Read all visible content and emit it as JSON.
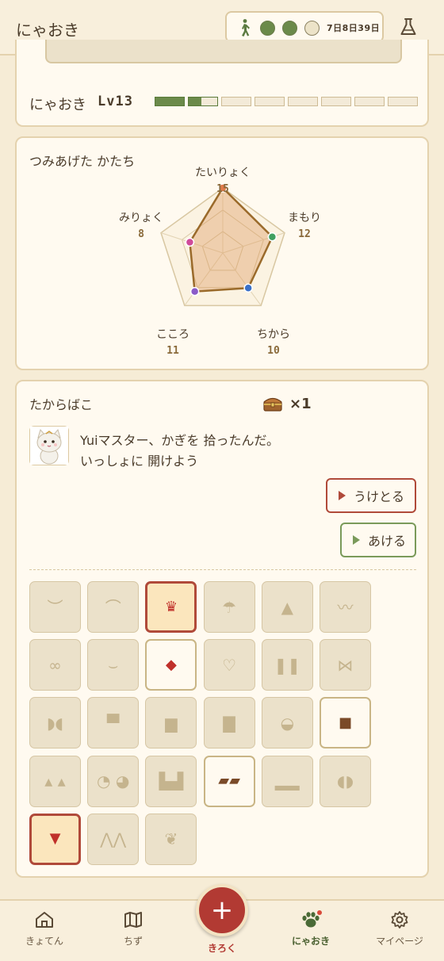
{
  "header": {
    "title": "にゃおき",
    "walk_time": "7日8日39日",
    "walk_time_display": "7日8日39日",
    "dots": [
      {
        "state": "filled",
        "color": "#6b8a4a"
      },
      {
        "state": "filled",
        "color": "#6b8a4a"
      },
      {
        "state": "empty",
        "color": "#ece3c8"
      }
    ]
  },
  "profile": {
    "name": "にゃおき",
    "level_label": "Lv13",
    "level_progress": {
      "segments": 8,
      "filled": 1,
      "partial_fraction": 0.45
    }
  },
  "stats": {
    "heading": "つみあげた かたち",
    "items": [
      {
        "label": "たいりょく",
        "value": "15",
        "color": "#e07a4a"
      },
      {
        "label": "まもり",
        "value": "12",
        "color": "#3fa060"
      },
      {
        "label": "ちから",
        "value": "10",
        "color": "#3a70c8"
      },
      {
        "label": "こころ",
        "value": "11",
        "color": "#8a5ac8"
      },
      {
        "label": "みりょく",
        "value": "8",
        "color": "#d04a9a"
      }
    ],
    "max": 15
  },
  "treasure": {
    "heading": "たからばこ",
    "count": "×1",
    "message_line1": "Yuiマスター、かぎを 拾ったんだ。",
    "message_line2": "いっしょに 開けよう",
    "receive_label": "うけとる",
    "open_label": "あける"
  },
  "items_grid": [
    {
      "icon": "cat-ears-icon",
      "glyph": "︶",
      "state": "locked"
    },
    {
      "icon": "headband-icon",
      "glyph": "⌒",
      "state": "locked"
    },
    {
      "icon": "tiara-icon",
      "glyph": "♛",
      "state": "equipped"
    },
    {
      "icon": "umbrella-hat-icon",
      "glyph": "☂",
      "state": "locked"
    },
    {
      "icon": "witch-hat-icon",
      "glyph": "▲",
      "state": "locked"
    },
    {
      "icon": "feather-icon",
      "glyph": "〰",
      "state": "locked"
    },
    {
      "icon": "glasses-icon",
      "glyph": "∞",
      "state": "locked"
    },
    {
      "icon": "necklace-icon",
      "glyph": "⌣",
      "state": "locked"
    },
    {
      "icon": "red-scarf-icon",
      "glyph": "◆",
      "state": "owned"
    },
    {
      "icon": "pendant-icon",
      "glyph": "♡",
      "state": "locked"
    },
    {
      "icon": "collar-icon",
      "glyph": "❚❚",
      "state": "locked"
    },
    {
      "icon": "bow-icon",
      "glyph": "⋈",
      "state": "locked"
    },
    {
      "icon": "leaf-pair-icon",
      "glyph": "◗◖",
      "state": "locked"
    },
    {
      "icon": "shirt-icon",
      "glyph": "▀",
      "state": "locked"
    },
    {
      "icon": "vest-icon",
      "glyph": "▆",
      "state": "locked"
    },
    {
      "icon": "dress-icon",
      "glyph": "▇",
      "state": "locked"
    },
    {
      "icon": "cape-icon",
      "glyph": "◒",
      "state": "locked"
    },
    {
      "icon": "brown-jacket-icon",
      "glyph": "■",
      "state": "owned"
    },
    {
      "icon": "small-shoes-icon",
      "glyph": "▴ ▴",
      "state": "locked"
    },
    {
      "icon": "slippers-icon",
      "glyph": "◔ ◕",
      "state": "locked"
    },
    {
      "icon": "boots-icon",
      "glyph": "▙▟",
      "state": "locked"
    },
    {
      "icon": "brown-shoes-icon",
      "glyph": "▰▰",
      "state": "owned"
    },
    {
      "icon": "sandals-icon",
      "glyph": "▂▂",
      "state": "locked"
    },
    {
      "icon": "paws-icon",
      "glyph": "◖◗",
      "state": "locked"
    },
    {
      "icon": "red-cape-icon",
      "glyph": "▼",
      "state": "equipped"
    },
    {
      "icon": "bat-wings-icon",
      "glyph": "⋀⋀",
      "state": "locked"
    },
    {
      "icon": "angel-wings-icon",
      "glyph": "❦",
      "state": "locked"
    }
  ],
  "nav": {
    "items": [
      {
        "label": "きょてん",
        "icon": "home-icon",
        "active": false
      },
      {
        "label": "ちず",
        "icon": "map-icon",
        "active": false
      },
      {
        "label": "にゃおき",
        "icon": "paw-icon",
        "active": true
      },
      {
        "label": "マイページ",
        "icon": "gear-icon",
        "active": false
      }
    ],
    "center_label": "きろく",
    "center_glyph": "+"
  },
  "colors": {
    "accent_red": "#b23a33",
    "accent_green": "#6b8a4a",
    "card_bg": "#fffaf0",
    "page_bg": "#f6ecd6"
  }
}
